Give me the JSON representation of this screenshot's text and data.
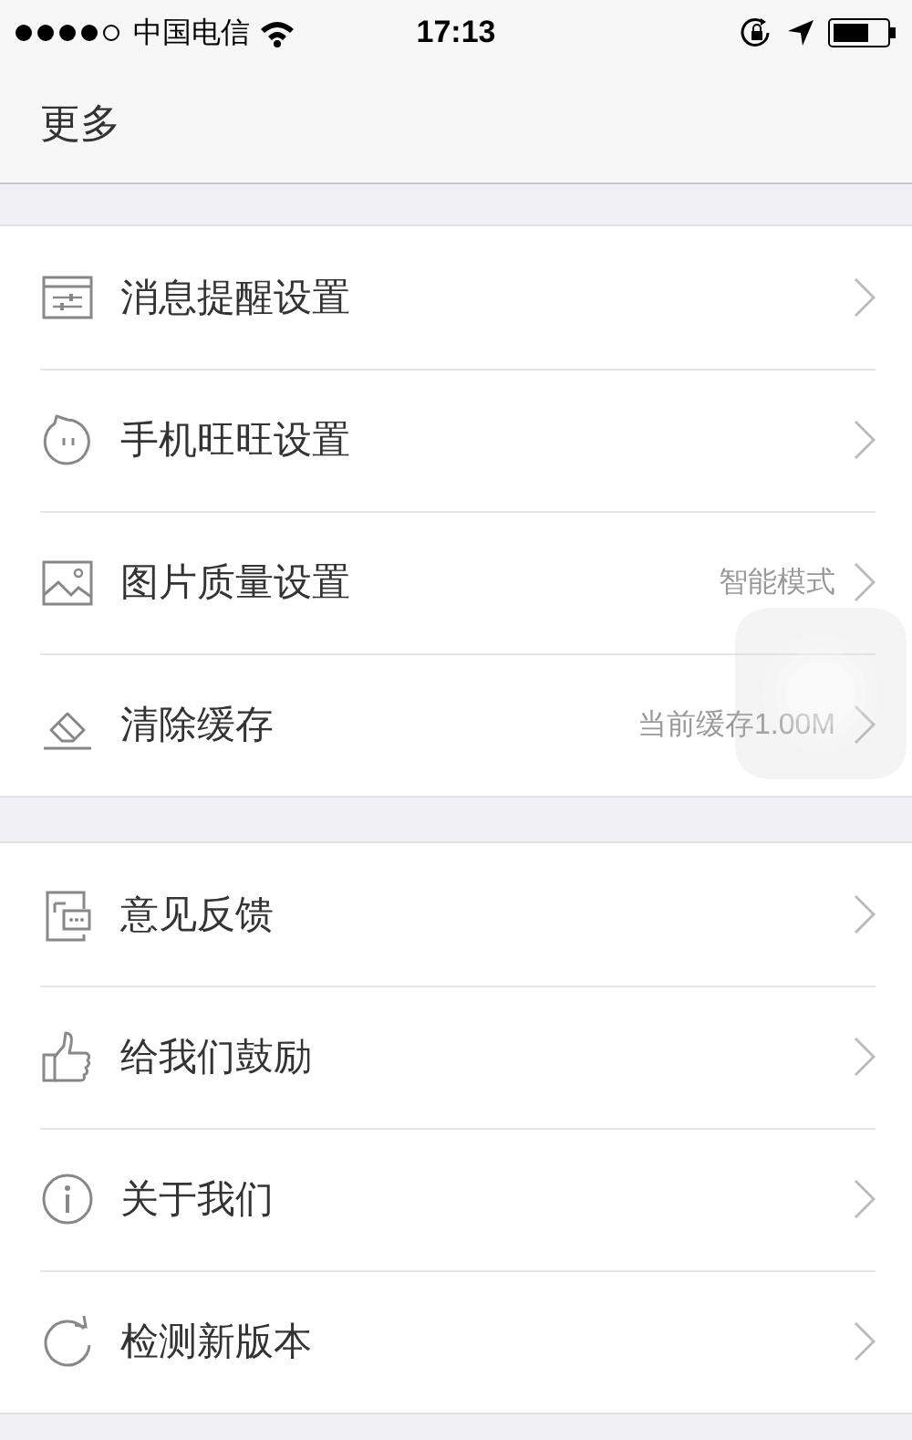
{
  "status_bar": {
    "carrier": "中国电信",
    "time": "17:13"
  },
  "header": {
    "title": "更多"
  },
  "sections": [
    {
      "items": [
        {
          "label": "消息提醒设置"
        },
        {
          "label": "手机旺旺设置"
        },
        {
          "label": "图片质量设置",
          "value": "智能模式"
        },
        {
          "label": "清除缓存",
          "value": "当前缓存1.00M"
        }
      ]
    },
    {
      "items": [
        {
          "label": "意见反馈"
        },
        {
          "label": "给我们鼓励"
        },
        {
          "label": "关于我们"
        },
        {
          "label": "检测新版本"
        }
      ]
    }
  ]
}
